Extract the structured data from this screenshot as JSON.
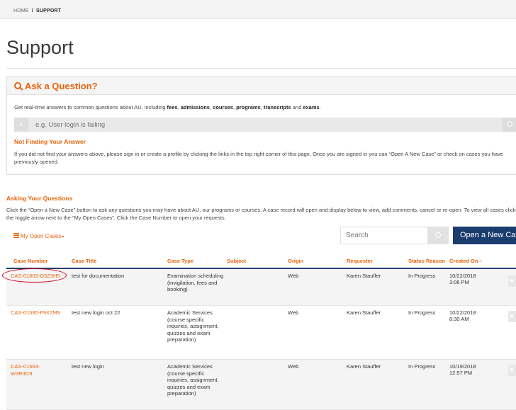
{
  "breadcrumb": {
    "home": "HOME",
    "separator": "/",
    "current": "SUPPORT"
  },
  "page": {
    "title": "Support"
  },
  "ask": {
    "title": "Ask a Question?",
    "intro_prefix": "Get real-time answers to common questions about AU, including ",
    "intro_terms": [
      "fees",
      "admissions",
      "courses",
      "programs",
      "transcripts",
      "exams"
    ],
    "intro_suffix": ".",
    "search_placeholder": "e.g. User login is failing",
    "clear_icon": "×",
    "not_found_title": "Not Finding Your Answer",
    "not_found_text": "If you did not find your answers above, please sign in or create a profile by clicking the links in the top right corner of this page. Once you are signed in you can “Open A New Case” or check on cases you have previously opened."
  },
  "asking": {
    "title": "Asking Your Questions",
    "text": "Click the “Open a New Case” button to ask any questions you may have about AU, our programs or courses. A case record will open and display below to view, add comments, cancel or re-open. To view all cases click the toggle arrow next to the “My Open Cases”. Click the Case Number to open your requests."
  },
  "cases_view": {
    "label": "My Open Cases",
    "caret": "▾"
  },
  "grid_search": {
    "placeholder": "Search"
  },
  "open_case_button": {
    "label": "Open a New Case"
  },
  "table": {
    "headers": {
      "case_number": "Case Number",
      "case_title": "Case Title",
      "case_type": "Case Type",
      "subject": "Subject",
      "origin": "Origin",
      "requester": "Requester",
      "status_reason": "Status Reason",
      "created_on": "Created On",
      "sort_arrow": "↑"
    },
    "rows": [
      {
        "case_number": "CAS-01602-G5Z3H5",
        "case_title": "test for documentation",
        "case_type": "Examination scheduling (invigilation, fees and booking)",
        "subject": "",
        "origin": "Web",
        "requester": "Karen Stauffer",
        "status_reason": "In Progress",
        "created_date": "10/22/2018",
        "created_time": "3:06 PM"
      },
      {
        "case_number": "CAS-01580-F9X7M9",
        "case_title": "test new login oct 22",
        "case_type": "Academic Services (course specific inquiries, assignment, quizzes and exam preparation)",
        "subject": "",
        "origin": "Web",
        "requester": "Karen Stauffer",
        "status_reason": "In Progress",
        "created_date": "10/22/2018",
        "created_time": "8:30 AM"
      },
      {
        "case_number": "CAS-01564-W3R3C9",
        "case_title": "test new login",
        "case_type": "Academic Services (course specific inquiries, assignment, quizzes and exam preparation)",
        "subject": "",
        "origin": "Web",
        "requester": "Karen Stauffer",
        "status_reason": "In Progress",
        "created_date": "10/19/2018",
        "created_time": "12:57 PM"
      }
    ]
  },
  "colors": {
    "accent": "#e8630a",
    "navy": "#1b3d6e",
    "annotation": "#d0021b"
  }
}
